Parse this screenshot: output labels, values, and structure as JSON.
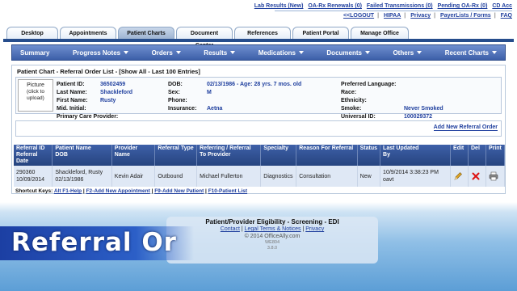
{
  "top_links": {
    "lab_results": "Lab Results (New)",
    "oa_rx_renewals": "OA-Rx Renewals (0)",
    "failed_transmissions": "Failed Transmissions (0)",
    "pending_oa_rx": "Pending OA-Rx (0)",
    "cd_access": "CD Acc",
    "logout": "<<LOGOUT",
    "hipaa": "HIPAA",
    "privacy": "Privacy",
    "payer_lists": "PayerLists / Forms",
    "faq": "FAQ"
  },
  "tabs": [
    "Desktop",
    "Appointments",
    "Patient Charts",
    "Document Center",
    "References",
    "Patient Portal",
    "Manage Office"
  ],
  "subnav": [
    "Summary",
    "Progress Notes",
    "Orders",
    "Results",
    "Medications",
    "Documents",
    "Others",
    "Recent Charts"
  ],
  "panel": {
    "title": "Patient Chart - Referral Order List - [Show All - Last 100 Entries]",
    "picture_title": "Picture",
    "picture_hint": "(click to upload)",
    "col1": [
      {
        "label": "Patient ID:",
        "value": "36502459"
      },
      {
        "label": "Last Name:",
        "value": "Shackleford"
      },
      {
        "label": "First Name:",
        "value": "Rusty"
      },
      {
        "label": "Mid. Initial:",
        "value": ""
      },
      {
        "label": "Primary Care Provider:",
        "value": ""
      }
    ],
    "col2": [
      {
        "label": "DOB:",
        "value": "02/13/1986 - Age: 28 yrs. 7 mos. old"
      },
      {
        "label": "Sex:",
        "value": "M"
      },
      {
        "label": "Phone:",
        "value": ""
      },
      {
        "label": "Insurance:",
        "value": "Aetna"
      }
    ],
    "col3": [
      {
        "label": "Preferred Language:",
        "value": ""
      },
      {
        "label": "Race:",
        "value": ""
      },
      {
        "label": "Ethnicity:",
        "value": ""
      },
      {
        "label": "Smoke:",
        "value": "Never Smoked"
      },
      {
        "label": "Universal ID:",
        "value": "100029372"
      }
    ],
    "add_referral": "Add New Referral Order"
  },
  "table": {
    "headers": {
      "referral_id": "Referral ID",
      "referral_date": "Referral Date",
      "patient_name": "Patient Name",
      "dob": "DOB",
      "provider_name": "Provider Name",
      "referral_type": "Referral Type",
      "referring_to": "Referring / Referral To Provider",
      "specialty": "Specialty",
      "reason": "Reason For Referral",
      "status": "Status",
      "last_updated": "Last Updated",
      "by": "By",
      "edit": "Edit",
      "del": "Del",
      "print": "Print"
    },
    "row": {
      "referral_id": "290360",
      "referral_date": "10/09/2014",
      "patient_name": "Shackleford, Rusty",
      "dob": "02/13/1986",
      "provider_name": "Kevin Adair",
      "referral_type": "Outbound",
      "referring_to": "Michael Fullerton",
      "specialty": "Diagnostics",
      "reason": "Consultation",
      "status": "New",
      "last_updated": "10/9/2014 3:38:23 PM",
      "by": "oavt"
    }
  },
  "shortcuts": {
    "label": "Shortcut Keys:",
    "items": [
      "Alt F1-Help",
      "F2-Add New Appointment",
      "F9-Add New Patient",
      "F10-Patient List"
    ]
  },
  "footer": {
    "title": "Patient/Provider Eligibility - Screening - EDI",
    "contact": "Contact",
    "legal": "Legal Terms & Notices",
    "privacy": "Privacy",
    "copyright": "© 2014 OfficeAlly.com",
    "code": "WE804",
    "version": "3.8.0"
  },
  "overlay_title": "Referral Or",
  "colors": {
    "nav_blue": "#3c5fa8",
    "header_blue": "#26447f",
    "link_blue": "#1f3f9e",
    "overlay_blue": "#1c3fa3"
  }
}
